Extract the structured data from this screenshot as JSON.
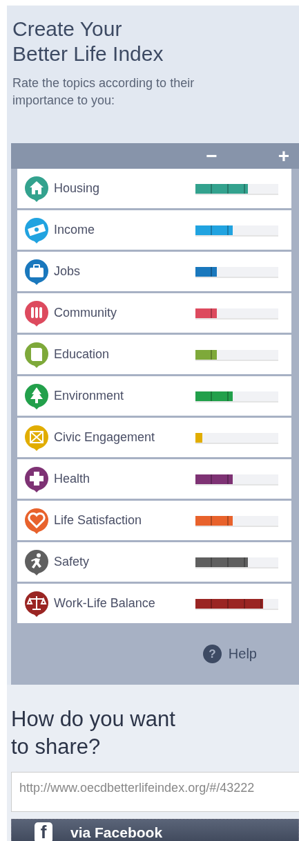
{
  "title_lines": [
    "Create Your",
    "Better Life Index"
  ],
  "intro": "Rate the topics according to their importance to you:",
  "scale": {
    "minus": "−",
    "plus": "+"
  },
  "topics": [
    {
      "kind": "house",
      "label": "Housing",
      "color": "#33a28e",
      "level": 0.63
    },
    {
      "kind": "money",
      "label": "Income",
      "color": "#21a3e0",
      "level": 0.45
    },
    {
      "kind": "briefcase",
      "label": "Jobs",
      "color": "#1a78bd",
      "level": 0.26
    },
    {
      "kind": "people",
      "label": "Community",
      "color": "#dd4a5e",
      "level": 0.26
    },
    {
      "kind": "book",
      "label": "Education",
      "color": "#7ea93a",
      "level": 0.26
    },
    {
      "kind": "tree",
      "label": "Environment",
      "color": "#22a04b",
      "level": 0.45
    },
    {
      "kind": "ballot",
      "label": "Civic Engagement",
      "color": "#e1ad00",
      "level": 0.08
    },
    {
      "kind": "cross",
      "label": "Health",
      "color": "#7e3274",
      "level": 0.45
    },
    {
      "kind": "heart",
      "label": "Life Satisfaction",
      "color": "#e8622c",
      "level": 0.45
    },
    {
      "kind": "runner",
      "label": "Safety",
      "color": "#5f5f5f",
      "level": 0.63
    },
    {
      "kind": "scales",
      "label": "Work-Life Balance",
      "color": "#9a2523",
      "level": 0.82
    }
  ],
  "help": {
    "icon": "?",
    "label": "Help"
  },
  "share": {
    "title_lines": [
      "How do you want",
      "to share?"
    ],
    "url": "http://www.oecdbetterlifeindex.org/#/43222",
    "facebook": {
      "icon": "f",
      "label": "via Facebook"
    }
  }
}
